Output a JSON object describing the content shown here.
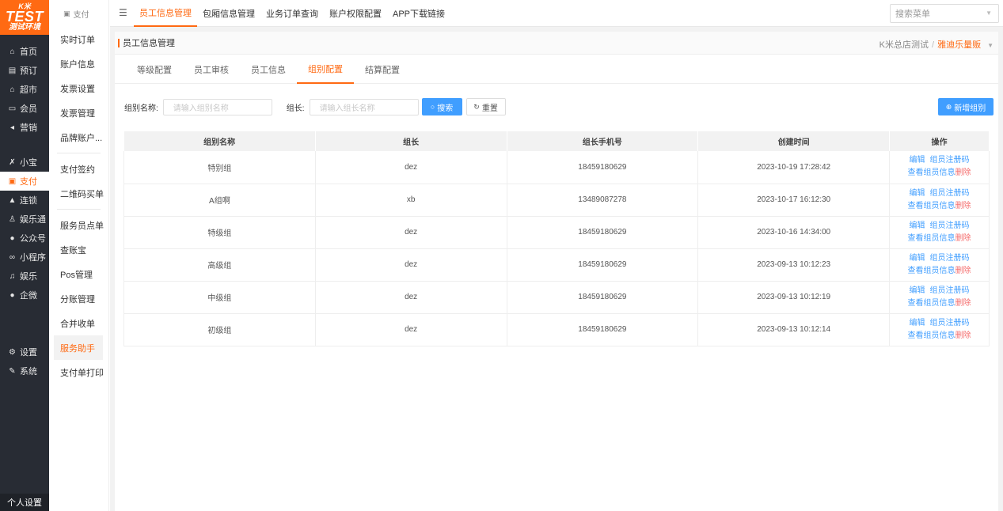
{
  "logo": {
    "brand": "K米",
    "test": "TEST",
    "env": "测试环境"
  },
  "nav": {
    "items": [
      {
        "label": "首页",
        "icon": "home-icon",
        "glyph": "⌂"
      },
      {
        "label": "预订",
        "icon": "calendar-icon",
        "glyph": "▤"
      },
      {
        "label": "超市",
        "icon": "store-icon",
        "glyph": "⌂"
      },
      {
        "label": "会员",
        "icon": "card-icon",
        "glyph": "▭"
      },
      {
        "label": "营销",
        "icon": "megaphone-icon",
        "glyph": "◂"
      },
      {
        "label": "小宝",
        "icon": "robot-icon",
        "glyph": "✗"
      },
      {
        "label": "支付",
        "icon": "pay-icon",
        "glyph": "▣"
      },
      {
        "label": "连锁",
        "icon": "chain-store-icon",
        "glyph": "▲"
      },
      {
        "label": "娱乐通",
        "icon": "person-icon",
        "glyph": "♙"
      },
      {
        "label": "公众号",
        "icon": "wechat-icon",
        "glyph": "●"
      },
      {
        "label": "小程序",
        "icon": "miniprogram-icon",
        "glyph": "∞"
      },
      {
        "label": "娱乐",
        "icon": "music-icon",
        "glyph": "♫"
      },
      {
        "label": "企微",
        "icon": "wecom-icon",
        "glyph": "●"
      },
      {
        "label": "设置",
        "icon": "gear-icon",
        "glyph": "⚙"
      },
      {
        "label": "系统",
        "icon": "wrench-icon",
        "glyph": "✎"
      }
    ],
    "footer": "个人设置"
  },
  "submenu": {
    "header": "支付",
    "items": [
      "实时订单",
      "账户信息",
      "发票设置",
      "发票管理",
      "品牌账户...",
      "支付签约",
      "二维码买单",
      "服务员点单",
      "查账宝",
      "Pos管理",
      "分账管理",
      "合并收单",
      "服务助手",
      "支付单打印"
    ]
  },
  "topnav": {
    "items": [
      "员工信息管理",
      "包厢信息管理",
      "业务订单查询",
      "账户权限配置",
      "APP下载链接"
    ],
    "search_placeholder": "搜索菜单"
  },
  "panel": {
    "title": "员工信息管理",
    "store_group": "K米总店测试",
    "store_current": "雅迪乐量贩"
  },
  "tabs": [
    "等级配置",
    "员工审核",
    "员工信息",
    "组别配置",
    "结算配置"
  ],
  "filters": {
    "group_label": "组别名称:",
    "group_placeholder": "请输入组别名称",
    "leader_label": "组长:",
    "leader_placeholder": "请输入组长名称",
    "search_btn": "搜索",
    "reset_btn": "重置",
    "new_btn": "新增组别"
  },
  "table": {
    "columns": [
      "组别名称",
      "组长",
      "组长手机号",
      "创建时间",
      "操作"
    ],
    "rows": [
      [
        "特别组",
        "dez",
        "18459180629",
        "2023-10-19 17:28:42"
      ],
      [
        "A组啊",
        "xb",
        "13489087278",
        "2023-10-17 16:12:30"
      ],
      [
        "特级组",
        "dez",
        "18459180629",
        "2023-10-16 14:34:00"
      ],
      [
        "高级组",
        "dez",
        "18459180629",
        "2023-09-13 10:12:23"
      ],
      [
        "中级组",
        "dez",
        "18459180629",
        "2023-09-13 10:12:19"
      ],
      [
        "初级组",
        "dez",
        "18459180629",
        "2023-09-13 10:12:14"
      ]
    ],
    "ops": {
      "edit": "编辑",
      "register_code": "组员注册码",
      "view_members": "查看组员信息",
      "delete": "删除"
    }
  },
  "colors": {
    "accent": "#ff6a13",
    "primary_blue": "#409eff",
    "danger": "#f56c6c",
    "nav_bg": "#282c34"
  }
}
